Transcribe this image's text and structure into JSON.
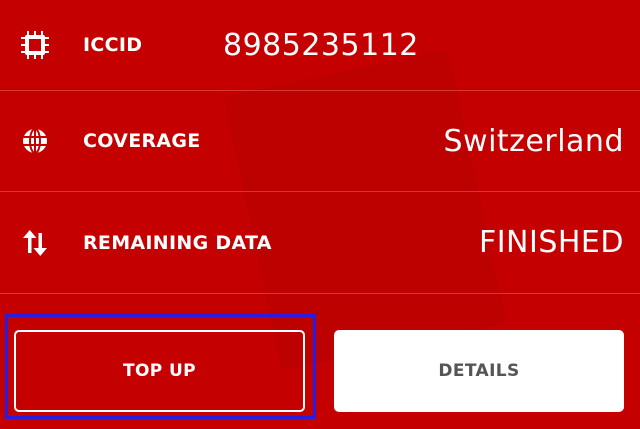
{
  "colors": {
    "background": "#c40000",
    "text": "#ffffff",
    "details_text": "#555555",
    "focus_ring": "#2a1be0"
  },
  "rows": [
    {
      "icon": "sim-chip-icon",
      "label": "ICCID",
      "value": "8985235112"
    },
    {
      "icon": "globe-icon",
      "label": "COVERAGE",
      "value": "Switzerland"
    },
    {
      "icon": "transfer-arrows-icon",
      "label": "REMAINING DATA",
      "value": "FINISHED"
    }
  ],
  "actions": {
    "top_up_label": "TOP UP",
    "details_label": "DETAILS"
  }
}
